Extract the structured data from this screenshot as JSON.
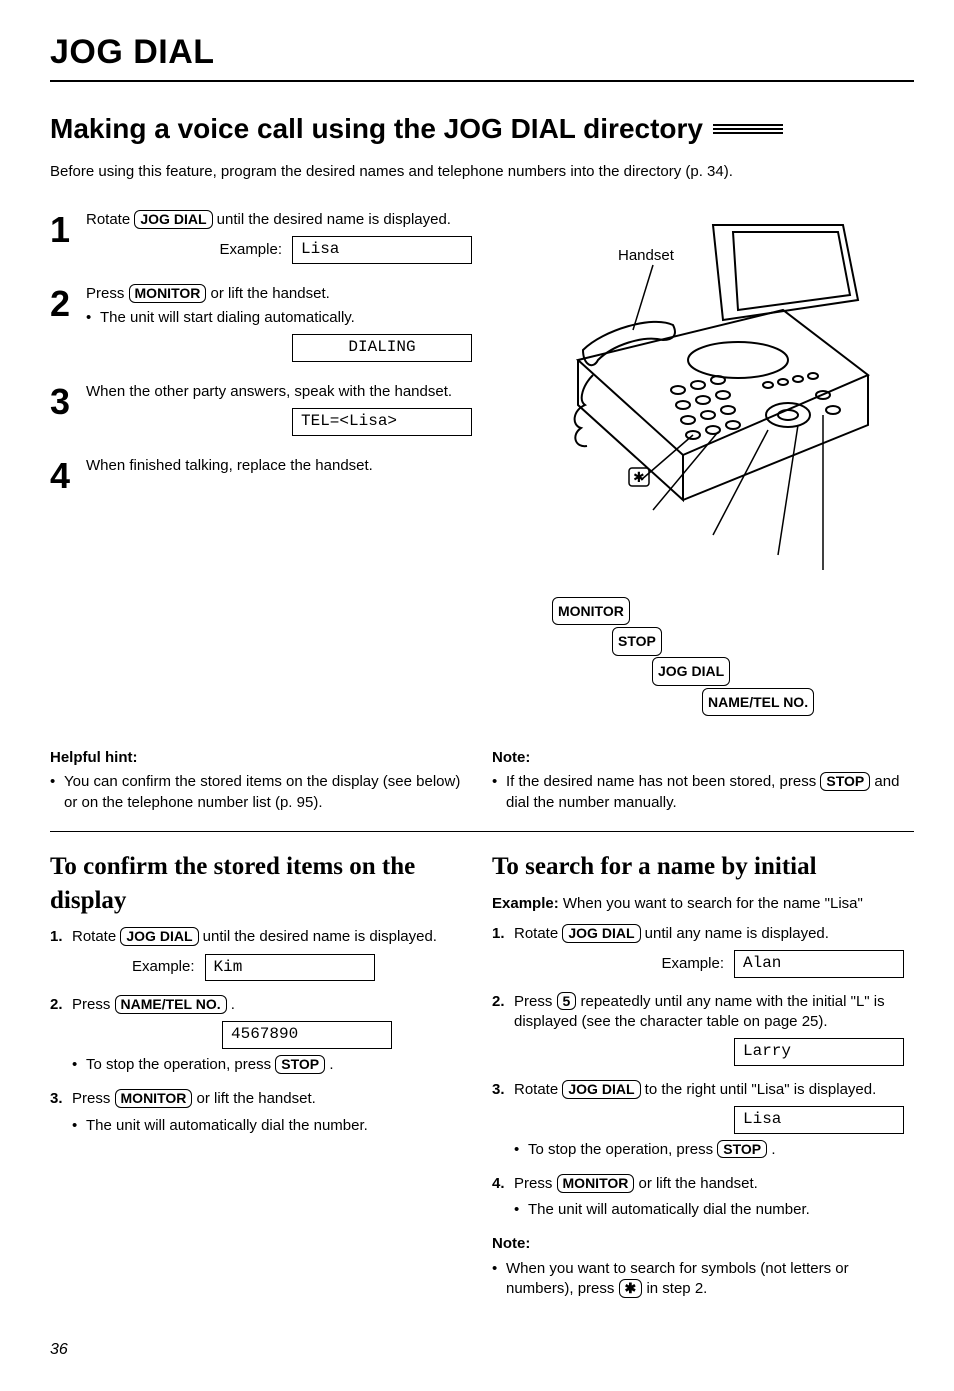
{
  "chapter": "JOG DIAL",
  "title": "Making a voice call using the JOG DIAL directory",
  "intro": "Before using this feature, program the desired names and telephone numbers into the directory (p. 34).",
  "buttons": {
    "jog_dial": "JOG DIAL",
    "monitor": "MONITOR",
    "stop": "STOP",
    "name_tel": "NAME/TEL NO.",
    "five": "5",
    "star": "✱"
  },
  "labels": {
    "example": "Example:",
    "handset": "Handset"
  },
  "steps": {
    "s1": {
      "num": "1",
      "text_before": "Rotate ",
      "text_after": " until the desired name is displayed.",
      "lcd": "Lisa"
    },
    "s2": {
      "num": "2",
      "text_before": "Press ",
      "text_after": " or lift the handset.",
      "bullet": "The unit will start dialing automatically.",
      "lcd": "DIALING"
    },
    "s3": {
      "num": "3",
      "text": "When the other party answers, speak with the handset.",
      "lcd": "TEL=<Lisa>"
    },
    "s4": {
      "num": "4",
      "text": "When finished talking, replace the handset."
    }
  },
  "hint": {
    "title": "Helpful hint:",
    "text": "You can confirm the stored items on the display (see below) or on the telephone number list (p. 95)."
  },
  "note1": {
    "title": "Note:",
    "text_before": "If the desired name has not been stored, press ",
    "text_after": " and dial the number manually."
  },
  "confirm": {
    "title": "To confirm the stored items on the display",
    "s1_before": "Rotate ",
    "s1_after": " until the desired name is displayed.",
    "s1_lcd": "Kim",
    "s2_before": "Press ",
    "s2_after": " .",
    "s2_lcd": "4567890",
    "s2_bullet_before": "To stop the operation, press ",
    "s2_bullet_after": ".",
    "s3_before": "Press ",
    "s3_after": " or lift the handset.",
    "s3_bullet": "The unit will automatically dial the number."
  },
  "search": {
    "title": "To search for a name by initial",
    "example_lead": "Example:",
    "example_text": " When you want to search for the name \"Lisa\"",
    "s1_before": "Rotate ",
    "s1_after": " until any name is displayed.",
    "s1_lcd": "Alan",
    "s2_before": "Press ",
    "s2_after": " repeatedly until any name with the initial \"L\" is displayed (see the character table on page 25).",
    "s2_lcd": "Larry",
    "s3_before": "Rotate ",
    "s3_after": " to the right until \"Lisa\" is displayed.",
    "s3_lcd": "Lisa",
    "s3_bullet_before": "To stop the operation, press ",
    "s3_bullet_after": ".",
    "s4_before": "Press ",
    "s4_after": " or lift the handset.",
    "s4_bullet": "The unit will automatically dial the number."
  },
  "note2": {
    "title": "Note:",
    "text_before": "When you want to search for symbols (not letters or numbers), press ",
    "text_after": " in step 2."
  },
  "page_number": "36"
}
